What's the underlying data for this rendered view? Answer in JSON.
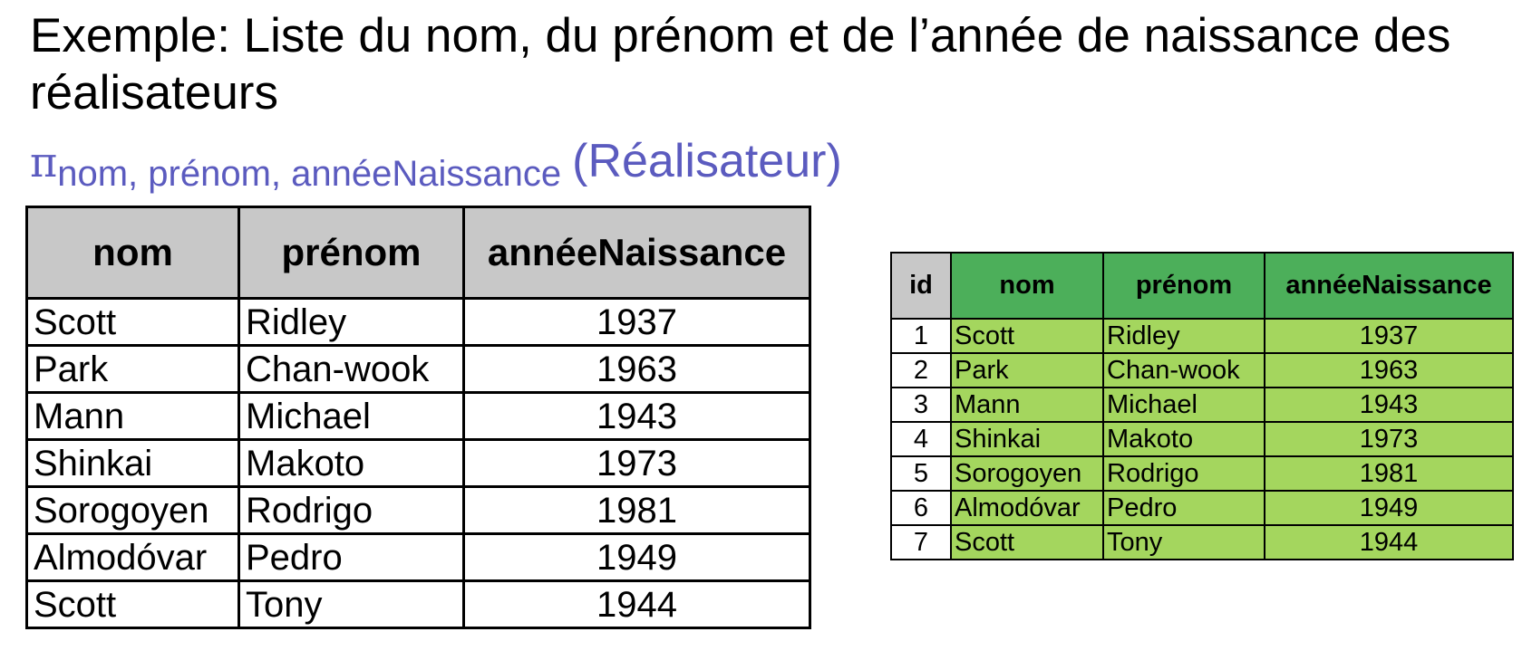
{
  "title": "Exemple: Liste du nom, du prénom et de l’année de naissance des réalisateurs",
  "formula": {
    "symbol": "π",
    "attributes": "nom, prénom, annéeNaissance",
    "relation": "(Réalisateur)",
    "color": "#5b5bbf"
  },
  "result_table": {
    "headers": [
      "nom",
      "prénom",
      "annéeNaissance"
    ],
    "rows": [
      [
        "Scott",
        "Ridley",
        "1937"
      ],
      [
        "Park",
        "Chan-wook",
        "1963"
      ],
      [
        "Mann",
        "Michael",
        "1943"
      ],
      [
        "Shinkai",
        "Makoto",
        "1973"
      ],
      [
        "Sorogoyen",
        "Rodrigo",
        "1981"
      ],
      [
        "Almodóvar",
        "Pedro",
        "1949"
      ],
      [
        "Scott",
        "Tony",
        "1944"
      ]
    ],
    "header_color": "#c8c8c8"
  },
  "source_table": {
    "headers": [
      "id",
      "nom",
      "prénom",
      "annéeNaissance"
    ],
    "rows": [
      [
        "1",
        "Scott",
        "Ridley",
        "1937"
      ],
      [
        "2",
        "Park",
        "Chan-wook",
        "1963"
      ],
      [
        "3",
        "Mann",
        "Michael",
        "1943"
      ],
      [
        "4",
        "Shinkai",
        "Makoto",
        "1973"
      ],
      [
        "5",
        "Sorogoyen",
        "Rodrigo",
        "1981"
      ],
      [
        "6",
        "Almodóvar",
        "Pedro",
        "1949"
      ],
      [
        "7",
        "Scott",
        "Tony",
        "1944"
      ]
    ],
    "id_header_color": "#c8c8c8",
    "header_color": "#4caf5a",
    "cell_color": "#a4d65e"
  }
}
